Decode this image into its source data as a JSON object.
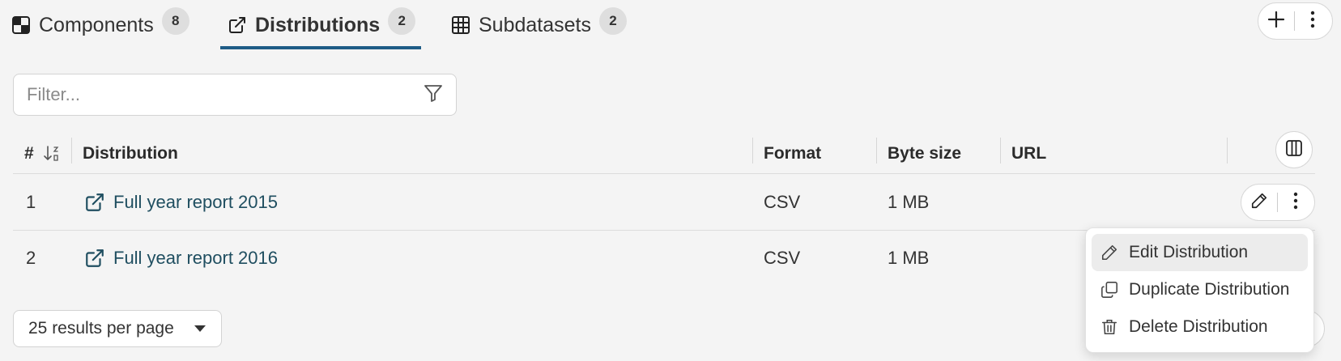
{
  "tabs": [
    {
      "label": "Components",
      "count": "8",
      "icon": "puzzle-icon"
    },
    {
      "label": "Distributions",
      "count": "2",
      "icon": "external-link-icon",
      "active": true
    },
    {
      "label": "Subdatasets",
      "count": "2",
      "icon": "grid-icon"
    }
  ],
  "toolbar": {
    "add_icon": "plus-icon",
    "more_icon": "kebab-icon"
  },
  "filter": {
    "placeholder": "Filter..."
  },
  "table": {
    "headers": {
      "index": "#",
      "distribution": "Distribution",
      "format": "Format",
      "byte_size": "Byte size",
      "url": "URL"
    },
    "rows": [
      {
        "index": "1",
        "name": "Full year report 2015",
        "format": "CSV",
        "byte_size": "1 MB",
        "url": ""
      },
      {
        "index": "2",
        "name": "Full year report 2016",
        "format": "CSV",
        "byte_size": "1 MB",
        "url": ""
      }
    ]
  },
  "pager": {
    "label": "25 results per page"
  },
  "context_menu": {
    "items": [
      {
        "label": "Edit Distribution",
        "icon": "pencil-icon"
      },
      {
        "label": "Duplicate Distribution",
        "icon": "copy-icon"
      },
      {
        "label": "Delete Distribution",
        "icon": "trash-icon"
      }
    ]
  },
  "colors": {
    "accent": "#1e5c86",
    "link": "#1f4e60",
    "background": "#f4f4f4"
  }
}
